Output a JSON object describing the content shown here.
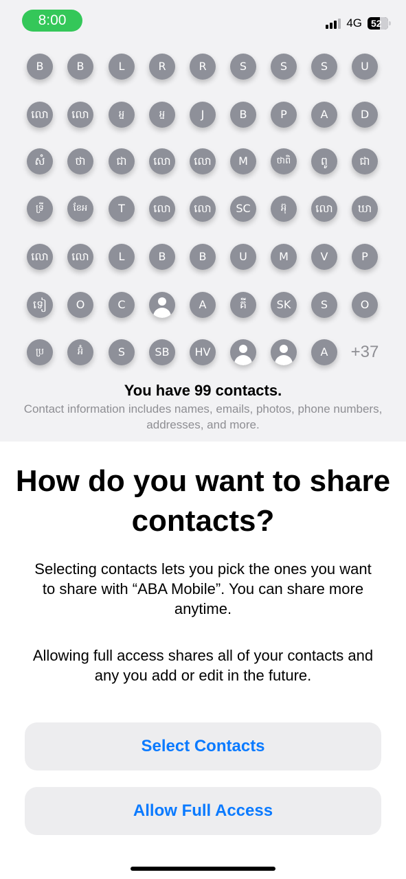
{
  "status_bar": {
    "time": "8:00",
    "network": "4G",
    "battery": "52",
    "time_pill_color": "#34c759",
    "signal_bars": 3
  },
  "contacts_grid": {
    "rows": [
      [
        "B",
        "B",
        "L",
        "R",
        "R",
        "S",
        "S",
        "S",
        "U"
      ],
      [
        "លោ",
        "លោ",
        "អ្ន",
        "អ្ន",
        "J",
        "B",
        "P",
        "A",
        "D"
      ],
      [
        "សំ",
        "ថា",
        "ជា",
        "លោ",
        "លោ",
        "M",
        "ថាពិ",
        "ពូ",
        "ជា"
      ],
      [
        "ទ្រី",
        "ខែអ",
        "T",
        "លោ",
        "លោ",
        "SC",
        "អ៊ុ",
        "លោ",
        "ឃា"
      ],
      [
        "លោ",
        "លោ",
        "L",
        "B",
        "B",
        "U",
        "M",
        "V",
        "P"
      ],
      [
        "ទៀ",
        "O",
        "C",
        "person-icon",
        "A",
        "គី",
        "SK",
        "S",
        "O"
      ],
      [
        "ប្រ",
        "អ៊ំ",
        "S",
        "SB",
        "HV",
        "person-icon",
        "person-icon",
        "A"
      ]
    ],
    "more_count": "+37",
    "bubble_color": "#8e9099"
  },
  "contacts_summary": {
    "title": "You have 99 contacts.",
    "subtitle": "Contact information includes names, emails, photos, phone numbers, addresses, and more."
  },
  "main": {
    "title": "How do you want to share contacts?",
    "paragraph1": "Selecting contacts lets you pick the ones you want to share with “ABA Mobile”. You can share more anytime.",
    "paragraph2": "Allowing full access shares all of your contacts and any you add or edit in the future."
  },
  "buttons": {
    "select_contacts": "Select Contacts",
    "allow_full_access": "Allow Full Access",
    "accent_color": "#0a7aff"
  }
}
